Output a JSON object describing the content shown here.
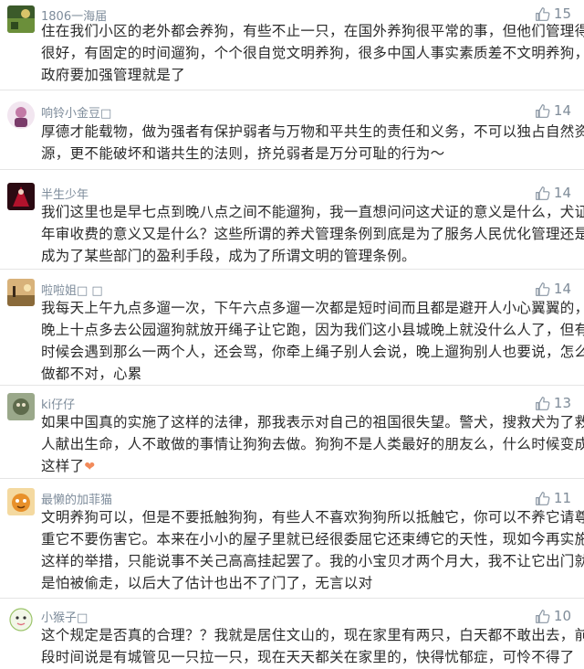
{
  "comments": [
    {
      "user": "1806一海届",
      "likes": "15",
      "lines": [
        "住在我们小区的老外都会养狗，有些不止一只，在国外养狗很平常的事，但他们管理得",
        "很好，有固定的时间遛狗，个个很自觉文明养狗，很多中国人事实素质差不文明养狗，",
        "政府要加强管理就是了"
      ]
    },
    {
      "user": "响铃小金豆□",
      "likes": "14",
      "lines": [
        "厚德才能载物，做为强者有保护弱者与万物和平共生的责任和义务，不可以独占自然资",
        "源，更不能破坏和谐共生的法则，挤兑弱者是万分可耻的行为～"
      ]
    },
    {
      "user": "半生少年",
      "likes": "14",
      "lines": [
        "我们这里也是早七点到晚八点之间不能遛狗，我一直想问问这犬证的意义是什么，犬证",
        "年审收费的意义又是什么？这些所谓的养犬管理条例到底是为了服务人民优化管理还是",
        "成为了某些部门的盈利手段，成为了所谓文明的管理条例。"
      ]
    },
    {
      "user": "啦啦姐□ □",
      "likes": "14",
      "lines": [
        "我每天上午九点多遛一次，下午六点多遛一次都是短时间而且都是避开人小心翼翼的，",
        "晚上十点多去公园遛狗就放开绳子让它跑，因为我们这小县城晚上就没什么人了，但有",
        "时候会遇到那么一两个人，还会骂，你牵上绳子别人会说，晚上遛狗别人也要说，怎么",
        "做都不对，心累"
      ]
    },
    {
      "user": "ki仔仔",
      "likes": "13",
      "lines": [
        "如果中国真的实施了这样的法律，那我表示对自己的祖国很失望。警犬，搜救犬为了救",
        "人献出生命，人不敢做的事情让狗狗去做。狗狗不是人类最好的朋友么，什么时候变成",
        "这样了"
      ],
      "emoji": "broken-heart"
    },
    {
      "user": "最懒的加菲猫",
      "likes": "11",
      "lines": [
        "文明养狗可以，但是不要抵触狗狗，有些人不喜欢狗狗所以抵触它，你可以不养它请尊",
        "重它不要伤害它。本来在小小的屋子里就已经很委屈它还束缚它的天性，现如今再实施",
        "这样的举措，只能说事不关己高高挂起罢了。我的小宝贝才两个月大，我不让它出门就",
        "是怕被偷走，以后大了估计也出不了门了，无言以对"
      ]
    },
    {
      "user": "小猴子□",
      "likes": "10",
      "lines": [
        "这个规定是否真的合理？？我就是居住文山的，现在家里有两只，白天都不敢出去，前",
        "段时间说是有城管见一只拉一只，现在天天都关在家里的，快得忧郁症，可怜不得了"
      ]
    }
  ],
  "colors": {
    "username": "#7e8c9b",
    "like": "#7f8c99",
    "text": "#2a2a2a",
    "divider": "#e5e5e5"
  },
  "icons": {
    "like": "thumbs-up-icon",
    "emoji": "broken-heart-icon"
  }
}
